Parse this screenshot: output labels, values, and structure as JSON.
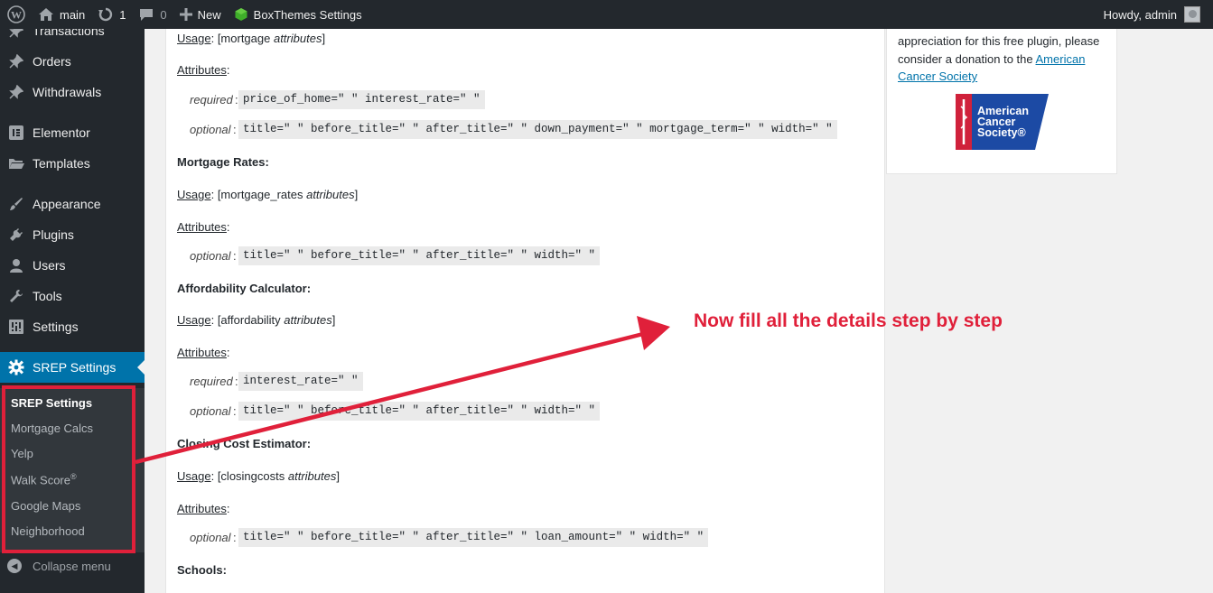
{
  "adminbar": {
    "site_name": "main",
    "updates_count": "1",
    "comments_count": "0",
    "new_label": "New",
    "plugin_label": "BoxThemes Settings",
    "howdy": "Howdy, admin"
  },
  "sidebar": {
    "items": [
      {
        "label": "Transactions",
        "icon": "pin-icon"
      },
      {
        "label": "Orders",
        "icon": "pin-icon"
      },
      {
        "label": "Withdrawals",
        "icon": "pin-icon"
      },
      {
        "label": "Elementor",
        "icon": "elementor-icon"
      },
      {
        "label": "Templates",
        "icon": "folder-icon"
      },
      {
        "label": "Appearance",
        "icon": "brush-icon"
      },
      {
        "label": "Plugins",
        "icon": "plug-icon"
      },
      {
        "label": "Users",
        "icon": "user-icon"
      },
      {
        "label": "Tools",
        "icon": "wrench-icon"
      },
      {
        "label": "Settings",
        "icon": "sliders-icon"
      },
      {
        "label": "SREP Settings",
        "icon": "gear-icon"
      }
    ],
    "submenu": [
      "SREP Settings",
      "Mortgage Calcs",
      "Yelp",
      "Walk Score",
      "Google Maps",
      "Neighborhood"
    ],
    "walkscore_mark": "®",
    "collapse_label": "Collapse menu"
  },
  "content": {
    "mortgage": {
      "usage_label": "Usage",
      "usage_code": "[mortgage ",
      "usage_italic": "attributes",
      "usage_end": "]",
      "attributes_label": "Attributes",
      "required_label": "required",
      "required_code": "price_of_home=\" \" interest_rate=\" \"",
      "optional_label": "optional",
      "optional_code": "title=\" \" before_title=\" \" after_title=\" \" down_payment=\" \" mortgage_term=\" \" width=\" \""
    },
    "rates": {
      "heading": "Mortgage Rates:",
      "usage_label": "Usage",
      "usage_code": "[mortgage_rates ",
      "usage_italic": "attributes",
      "usage_end": "]",
      "attributes_label": "Attributes",
      "optional_label": "optional",
      "optional_code": "title=\" \" before_title=\" \" after_title=\" \" width=\" \""
    },
    "affordability": {
      "heading": "Affordability Calculator:",
      "usage_label": "Usage",
      "usage_code": "[affordability ",
      "usage_italic": "attributes",
      "usage_end": "]",
      "attributes_label": "Attributes",
      "required_label": "required",
      "required_code": "interest_rate=\" \"",
      "optional_label": "optional",
      "optional_code": "title=\" \" before_title=\" \" after_title=\" \" width=\" \""
    },
    "closing": {
      "heading": "Closing Cost Estimator:",
      "usage_label": "Usage",
      "usage_code": "[closingcosts ",
      "usage_italic": "attributes",
      "usage_end": "]",
      "attributes_label": "Attributes",
      "optional_label": "optional",
      "optional_code": "title=\" \" before_title=\" \" after_title=\" \" loan_amount=\" \" width=\" \""
    },
    "schools_heading": "Schools:"
  },
  "widget": {
    "text_1": "appreciation for this free plugin, please consider a donation to the ",
    "link": "American Cancer Society",
    "logo_line_1": "American",
    "logo_line_2": "Cancer",
    "logo_line_3": "Society®"
  },
  "annotation": {
    "text": "Now fill all the details step by step",
    "color": "#e0203a"
  },
  "colors": {
    "adminbar_bg": "#23282d",
    "sidebar_current": "#0073aa",
    "link": "#0073aa"
  }
}
